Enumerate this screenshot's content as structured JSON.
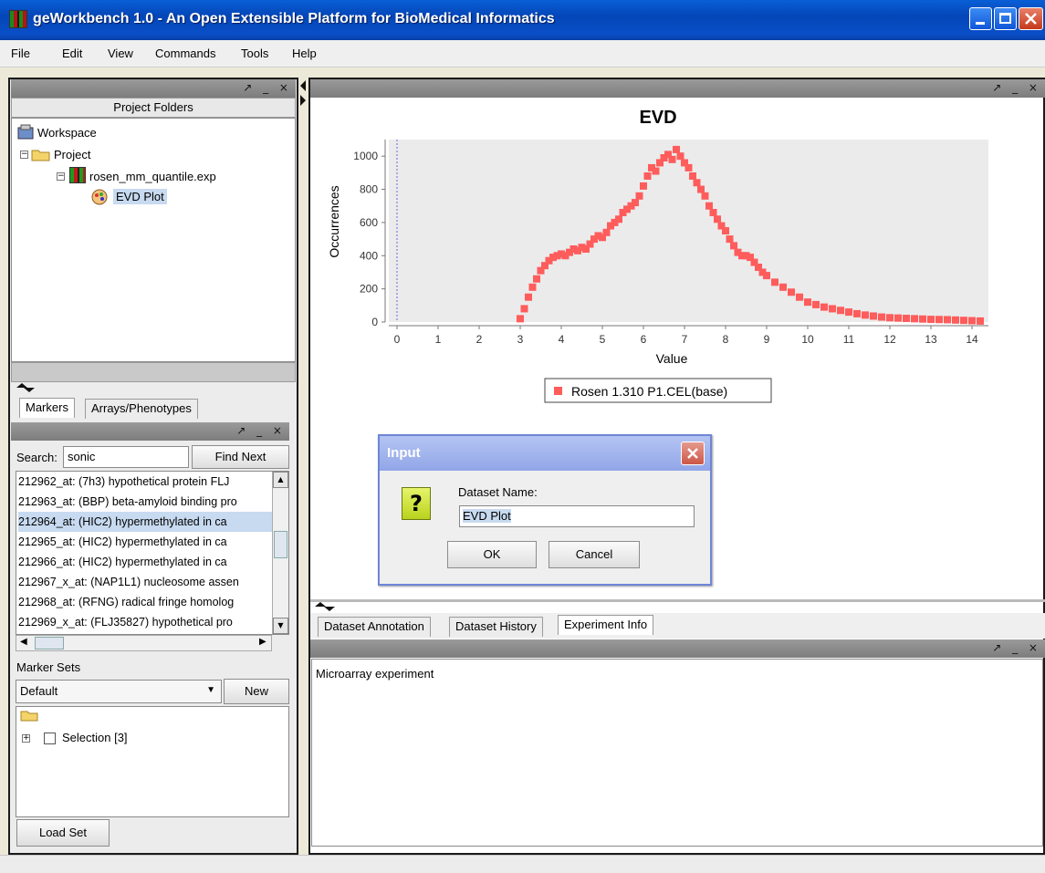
{
  "window": {
    "title": "geWorkbench 1.0 - An Open Extensible Platform for BioMedical Informatics"
  },
  "menu": [
    "File",
    "Edit",
    "View",
    "Commands",
    "Tools",
    "Help"
  ],
  "project_panel": {
    "header": "Project Folders",
    "tree": {
      "workspace": "Workspace",
      "project": "Project",
      "dataset": "rosen_mm_quantile.exp",
      "plot": "EVD Plot"
    }
  },
  "markers_panel": {
    "tabs": [
      "Markers",
      "Arrays/Phenotypes"
    ],
    "search_label": "Search:",
    "search_value": "sonic",
    "find_next": "Find Next",
    "items": [
      "212962_at: (7h3) hypothetical protein FLJ",
      "212963_at: (BBP) beta-amyloid binding pro",
      "212964_at: (HIC2) hypermethylated in ca",
      "212965_at: (HIC2) hypermethylated in ca",
      "212966_at: (HIC2) hypermethylated in ca",
      "212967_x_at: (NAP1L1) nucleosome assen",
      "212968_at: (RFNG) radical fringe homolog",
      "212969_x_at: (FLJ35827) hypothetical pro"
    ],
    "selected_index": 2
  },
  "marker_sets": {
    "label": "Marker Sets",
    "select_value": "Default",
    "new_button": "New",
    "selection_item": "Selection [3]",
    "load_button": "Load Set"
  },
  "chart_data": {
    "type": "scatter",
    "title": "EVD",
    "xlabel": "Value",
    "ylabel": "Occurrences",
    "xlim": [
      -0.2,
      14.4
    ],
    "ylim": [
      0,
      1100
    ],
    "xticks": [
      0,
      1,
      2,
      3,
      4,
      5,
      6,
      7,
      8,
      9,
      10,
      11,
      12,
      13,
      14
    ],
    "yticks": [
      0,
      200,
      400,
      600,
      800,
      1000
    ],
    "legend": "Rosen 1.310 P1.CEL(base)",
    "legend_position": "bottom",
    "color": "#ff5c5c",
    "x": [
      3.0,
      3.1,
      3.2,
      3.3,
      3.4,
      3.5,
      3.6,
      3.7,
      3.8,
      3.9,
      4.0,
      4.1,
      4.2,
      4.3,
      4.4,
      4.5,
      4.6,
      4.7,
      4.8,
      4.9,
      5.0,
      5.1,
      5.2,
      5.3,
      5.4,
      5.5,
      5.6,
      5.7,
      5.8,
      5.9,
      6.0,
      6.1,
      6.2,
      6.3,
      6.4,
      6.5,
      6.6,
      6.7,
      6.8,
      6.9,
      7.0,
      7.1,
      7.2,
      7.3,
      7.4,
      7.5,
      7.6,
      7.7,
      7.8,
      7.9,
      8.0,
      8.1,
      8.2,
      8.3,
      8.4,
      8.5,
      8.6,
      8.7,
      8.8,
      8.9,
      9.0,
      9.2,
      9.4,
      9.6,
      9.8,
      10.0,
      10.2,
      10.4,
      10.6,
      10.8,
      11.0,
      11.2,
      11.4,
      11.6,
      11.8,
      12.0,
      12.2,
      12.4,
      12.6,
      12.8,
      13.0,
      13.2,
      13.4,
      13.6,
      13.8,
      14.0,
      14.2
    ],
    "y": [
      20,
      80,
      150,
      210,
      260,
      310,
      340,
      370,
      390,
      400,
      410,
      400,
      420,
      440,
      430,
      450,
      440,
      470,
      500,
      520,
      510,
      540,
      580,
      600,
      620,
      660,
      680,
      700,
      720,
      760,
      820,
      880,
      930,
      910,
      960,
      990,
      1010,
      980,
      1040,
      1000,
      960,
      930,
      880,
      840,
      800,
      760,
      700,
      660,
      620,
      580,
      550,
      500,
      460,
      420,
      400,
      400,
      390,
      360,
      330,
      300,
      280,
      240,
      210,
      180,
      150,
      120,
      105,
      90,
      80,
      70,
      60,
      50,
      42,
      36,
      30,
      26,
      24,
      22,
      20,
      18,
      16,
      15,
      14,
      12,
      10,
      8,
      6
    ]
  },
  "dialog": {
    "title": "Input",
    "prompt": "Dataset Name:",
    "value": "EVD Plot",
    "ok": "OK",
    "cancel": "Cancel"
  },
  "bottom_panel": {
    "tabs": [
      "Dataset Annotation",
      "Dataset History",
      "Experiment Info"
    ],
    "active_tab": 2,
    "content": "Microarray experiment"
  },
  "panel_controls": "↗ _ ×"
}
